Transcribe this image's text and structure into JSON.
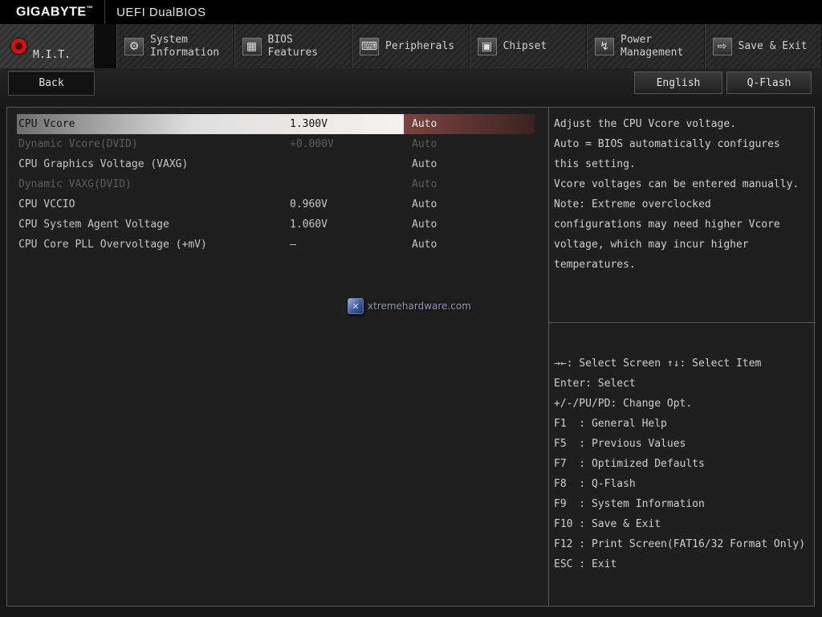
{
  "header": {
    "brand": "GIGABYTE",
    "brand_tm": "™",
    "title": "UEFI DualBIOS"
  },
  "tabs": [
    {
      "label": "M.I.T.",
      "icon": "record-dot-icon",
      "active": true
    },
    {
      "label": "System Information",
      "icon": "gear-icon",
      "glyph": "⚙"
    },
    {
      "label": "BIOS Features",
      "icon": "bios-grid-icon",
      "glyph": "▦"
    },
    {
      "label": "Peripherals",
      "icon": "peripherals-icon",
      "glyph": "⌨"
    },
    {
      "label": "Chipset",
      "icon": "chipset-icon",
      "glyph": "▣"
    },
    {
      "label": "Power Management",
      "icon": "power-icon",
      "glyph": "↯"
    },
    {
      "label": "Save & Exit",
      "icon": "save-exit-icon",
      "glyph": "⇨"
    }
  ],
  "toolbar": {
    "back_label": "Back",
    "english_label": "English",
    "qflash_label": "Q-Flash"
  },
  "settings": {
    "rows": [
      {
        "name": "CPU Vcore",
        "value": "1.300V",
        "option": "Auto",
        "state": "selected"
      },
      {
        "name": "Dynamic Vcore(DVID)",
        "value": "+0.000V",
        "option": "Auto",
        "state": "disabled"
      },
      {
        "name": "CPU Graphics Voltage (VAXG)",
        "value": "",
        "option": "Auto",
        "state": "normal"
      },
      {
        "name": "Dynamic VAXG(DVID)",
        "value": "",
        "option": "Auto",
        "state": "disabled"
      },
      {
        "name": "CPU VCCIO",
        "value": "0.960V",
        "option": "Auto",
        "state": "normal"
      },
      {
        "name": "CPU System Agent Voltage",
        "value": "1.060V",
        "option": "Auto",
        "state": "normal"
      },
      {
        "name": "CPU Core PLL Overvoltage (+mV)",
        "value": "–",
        "option": "Auto",
        "state": "normal"
      }
    ]
  },
  "watermark": {
    "text": "xtremehardware.com",
    "icon": "xtremehardware-cube-icon",
    "glyph": "✕"
  },
  "help": {
    "description_lines": [
      "Adjust the CPU Vcore voltage.",
      "Auto = BIOS automatically configures",
      "this setting.",
      "Vcore voltages can be entered manually.",
      "Note: Extreme overclocked",
      "configurations may need higher Vcore",
      "voltage, which may incur higher",
      "temperatures."
    ],
    "keys": [
      "→←: Select Screen ↑↓: Select Item",
      "Enter: Select",
      "+/-/PU/PD: Change Opt.",
      "F1  : General Help",
      "F5  : Previous Values",
      "F7  : Optimized Defaults",
      "F8  : Q-Flash",
      "F9  : System Information",
      "F10 : Save & Exit",
      "F12 : Print Screen(FAT16/32 Format Only)",
      "ESC : Exit"
    ]
  },
  "colors": {
    "accent_red": "#d31414",
    "text": "#c6c6c6",
    "disabled_text": "#5c5c5c",
    "panel_border": "#585858"
  }
}
